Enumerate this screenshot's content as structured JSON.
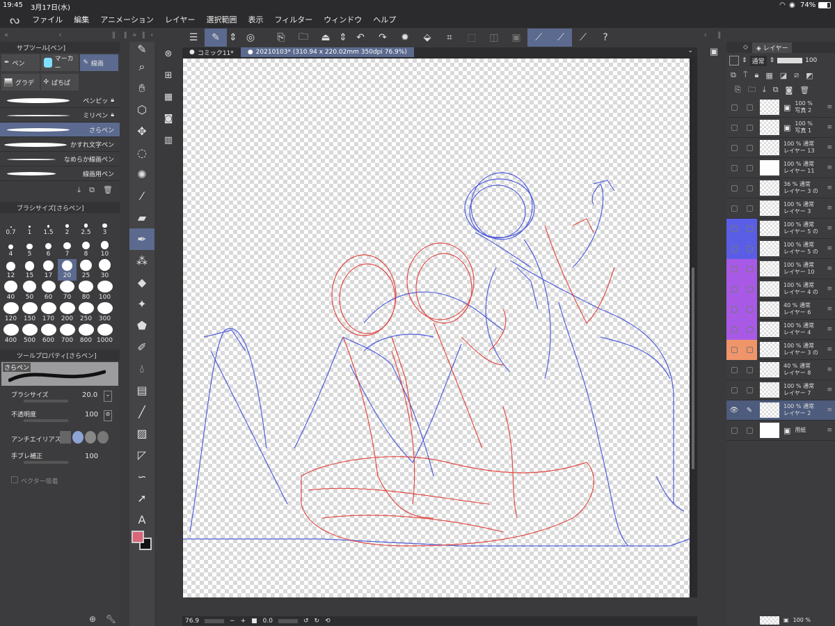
{
  "status": {
    "time": "19:45",
    "date": "3月17日(水)",
    "battery": "74%"
  },
  "menu": [
    "ファイル",
    "編集",
    "アニメーション",
    "レイヤー",
    "選択範囲",
    "表示",
    "フィルター",
    "ウィンドウ",
    "ヘルプ"
  ],
  "subtool": {
    "title": "サブツール[ペン]",
    "tabs": [
      "ペン",
      "マーカー",
      "線画",
      "グラデ",
      "ぱちぱ"
    ],
    "brushes": [
      "ペンピッ",
      "ミリペン",
      "さらペン",
      "かすれ文字ペン",
      "なめらか線画ペン",
      "線画用ペン"
    ]
  },
  "brushsize": {
    "title": "ブラシサイズ[さらペン]",
    "sizes": [
      "0.7",
      "1",
      "1.5",
      "2",
      "2.5",
      "3",
      "4",
      "5",
      "6",
      "7",
      "8",
      "10",
      "12",
      "15",
      "17",
      "20",
      "25",
      "30",
      "40",
      "50",
      "60",
      "70",
      "80",
      "100",
      "120",
      "150",
      "170",
      "200",
      "250",
      "300",
      "400",
      "500",
      "600",
      "700",
      "800",
      "1000"
    ],
    "selected": "20"
  },
  "toolprop": {
    "title": "ツールプロパティ[さらペン]",
    "preview_label": "さらペン",
    "brush_size_label": "ブラシサイズ",
    "brush_size": "20.0",
    "opacity_label": "不透明度",
    "opacity": "100",
    "antialias_label": "アンチエイリアス",
    "stabilize_label": "手ブレ補正",
    "stabilize": "100",
    "vector_label": "ベクター吸着"
  },
  "tabs": [
    "コミック11*",
    "20210103* (310.94 x 220.02mm 350dpi 76.9%)"
  ],
  "bottom": {
    "zoom": "76.9",
    "angle": "0.0"
  },
  "colors": {
    "main": "#d9667a",
    "sub": "#111111",
    "accent": "#5b6a8e"
  },
  "layerpanel": {
    "tab": "レイヤー",
    "blend": "通常",
    "opacity": "100",
    "layers": [
      {
        "pct": "100 %",
        "name": "写真 2",
        "color": ""
      },
      {
        "pct": "100 %",
        "name": "写真 1",
        "color": ""
      },
      {
        "pct": "100 % 通常",
        "name": "レイヤー 13",
        "color": ""
      },
      {
        "pct": "100 % 通常",
        "name": "レイヤー 11",
        "color": ""
      },
      {
        "pct": "36 % 通常",
        "name": "レイヤー 3 の",
        "color": ""
      },
      {
        "pct": "100 % 通常",
        "name": "レイヤー 3",
        "color": ""
      },
      {
        "pct": "100 % 通常",
        "name": "レイヤー 5 の",
        "color": "#5a5ee6"
      },
      {
        "pct": "100 % 通常",
        "name": "レイヤー 5 の",
        "color": "#5a5ee6"
      },
      {
        "pct": "100 % 通常",
        "name": "レイヤー 10",
        "color": "#a85ae6"
      },
      {
        "pct": "100 % 通常",
        "name": "レイヤー 4 の",
        "color": "#a85ae6"
      },
      {
        "pct": "40 % 通常",
        "name": "レイヤー 6",
        "color": "#a85ae6"
      },
      {
        "pct": "100 % 通常",
        "name": "レイヤー 4",
        "color": "#a85ae6"
      },
      {
        "pct": "100 % 通常",
        "name": "レイヤー 3 の",
        "color": "#f0946a"
      },
      {
        "pct": "40 % 通常",
        "name": "レイヤー 8",
        "color": ""
      },
      {
        "pct": "100 % 通常",
        "name": "レイヤー 7",
        "color": ""
      },
      {
        "pct": "100 % 通常",
        "name": "レイヤー 2",
        "color": ""
      },
      {
        "pct": "",
        "name": "用紙",
        "color": ""
      }
    ],
    "bottom_pct": "100 %"
  }
}
